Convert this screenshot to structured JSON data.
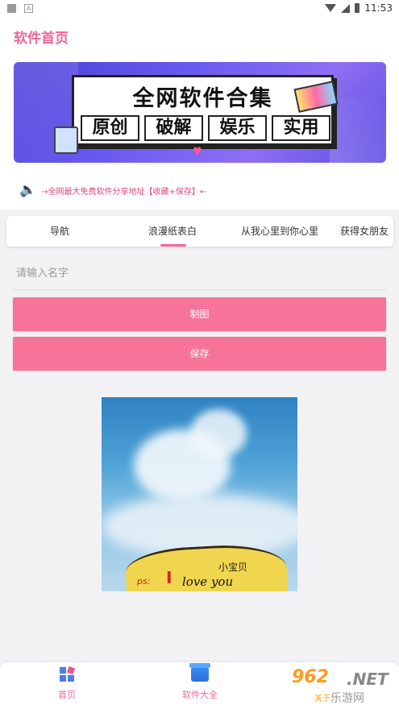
{
  "status_bar": {
    "time": "11:53",
    "notif_icon_2": "A"
  },
  "header": {
    "title": "软件首页"
  },
  "banner": {
    "title": "全网软件合集",
    "tags": [
      "原创",
      "破解",
      "娱乐",
      "实用"
    ]
  },
  "notice": {
    "text": "→全网最大免费软件分享地址【收藏+保存】←"
  },
  "tabs": [
    {
      "label": "导航"
    },
    {
      "label": "浪漫纸表白",
      "active": true
    },
    {
      "label": "从我心里到你心里"
    },
    {
      "label": "获得女朋友"
    }
  ],
  "form": {
    "name_placeholder": "请输入名字",
    "draw_label": "制图",
    "save_label": "保存"
  },
  "preview": {
    "name": "小宝贝",
    "love_text": "love you",
    "i_text": "I",
    "ps_text": "ps:"
  },
  "bottom_nav": [
    {
      "label": "首页",
      "icon": "home-grid-icon"
    },
    {
      "label": "软件大全",
      "icon": "box-icon"
    }
  ],
  "watermark": {
    "num": "962",
    "net": ".NET",
    "site": "乐游网",
    "extra": "关于"
  },
  "colors": {
    "accent": "#f0679a",
    "button": "#f77399",
    "banner": "#5a4de0"
  }
}
